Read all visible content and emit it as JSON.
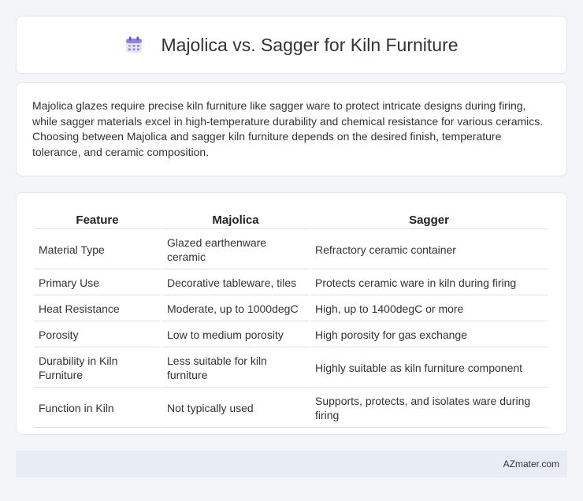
{
  "header": {
    "title": "Majolica vs. Sagger for Kiln Furniture",
    "icon": "calendar-icon"
  },
  "intro": {
    "text": "Majolica glazes require precise kiln furniture like sagger ware to protect intricate designs during firing, while sagger materials excel in high-temperature durability and chemical resistance for various ceramics. Choosing between Majolica and sagger kiln furniture depends on the desired finish, temperature tolerance, and ceramic composition."
  },
  "table": {
    "columns": [
      "Feature",
      "Majolica",
      "Sagger"
    ],
    "rows": [
      [
        "Material Type",
        "Glazed earthenware ceramic",
        "Refractory ceramic container"
      ],
      [
        "Primary Use",
        "Decorative tableware, tiles",
        "Protects ceramic ware in kiln during firing"
      ],
      [
        "Heat Resistance",
        "Moderate, up to 1000degC",
        "High, up to 1400degC or more"
      ],
      [
        "Porosity",
        "Low to medium porosity",
        "High porosity for gas exchange"
      ],
      [
        "Durability in Kiln Furniture",
        "Less suitable for kiln furniture",
        "Highly suitable as kiln furniture component"
      ],
      [
        "Function in Kiln",
        "Not typically used",
        "Supports, protects, and isolates ware during firing"
      ]
    ]
  },
  "footer": {
    "source": "AZmater.com"
  },
  "colors": {
    "background": "#f3f5f9",
    "card": "#ffffff",
    "footer_bg": "#e8edf5",
    "icon_accent": "#7b6fd8"
  }
}
